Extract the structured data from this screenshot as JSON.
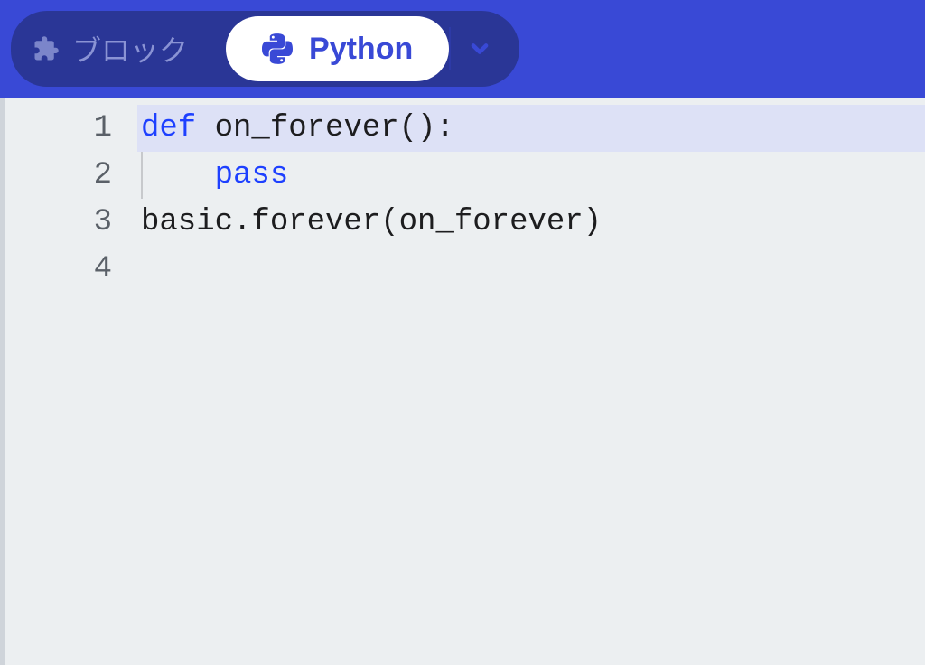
{
  "toolbar": {
    "blocks_tab": {
      "label": "ブロック",
      "icon": "puzzle-piece-icon"
    },
    "python_tab": {
      "label": "Python",
      "icon": "python-icon"
    },
    "dropdown_icon": "chevron-down-icon"
  },
  "editor": {
    "lines": [
      {
        "num": "1",
        "tokens": [
          {
            "text": "def ",
            "cls": "tk-kw"
          },
          {
            "text": "on_forever():",
            "cls": "tk-def"
          }
        ],
        "highlight": true,
        "indentGuide": false
      },
      {
        "num": "2",
        "tokens": [
          {
            "text": "    ",
            "cls": ""
          },
          {
            "text": "pass",
            "cls": "tk-kw"
          }
        ],
        "highlight": false,
        "indentGuide": true
      },
      {
        "num": "3",
        "tokens": [
          {
            "text": "basic.forever(on_forever)",
            "cls": "tk-def"
          }
        ],
        "highlight": false,
        "indentGuide": false
      },
      {
        "num": "4",
        "tokens": [
          {
            "text": "",
            "cls": ""
          }
        ],
        "highlight": false,
        "indentGuide": false
      }
    ]
  },
  "colors": {
    "toolbar_bg": "#3949d6",
    "tab_dark": "#2a3696",
    "accent": "#1e40ff",
    "editor_bg": "#eceff1",
    "highlight_bg": "#dde1f6"
  }
}
